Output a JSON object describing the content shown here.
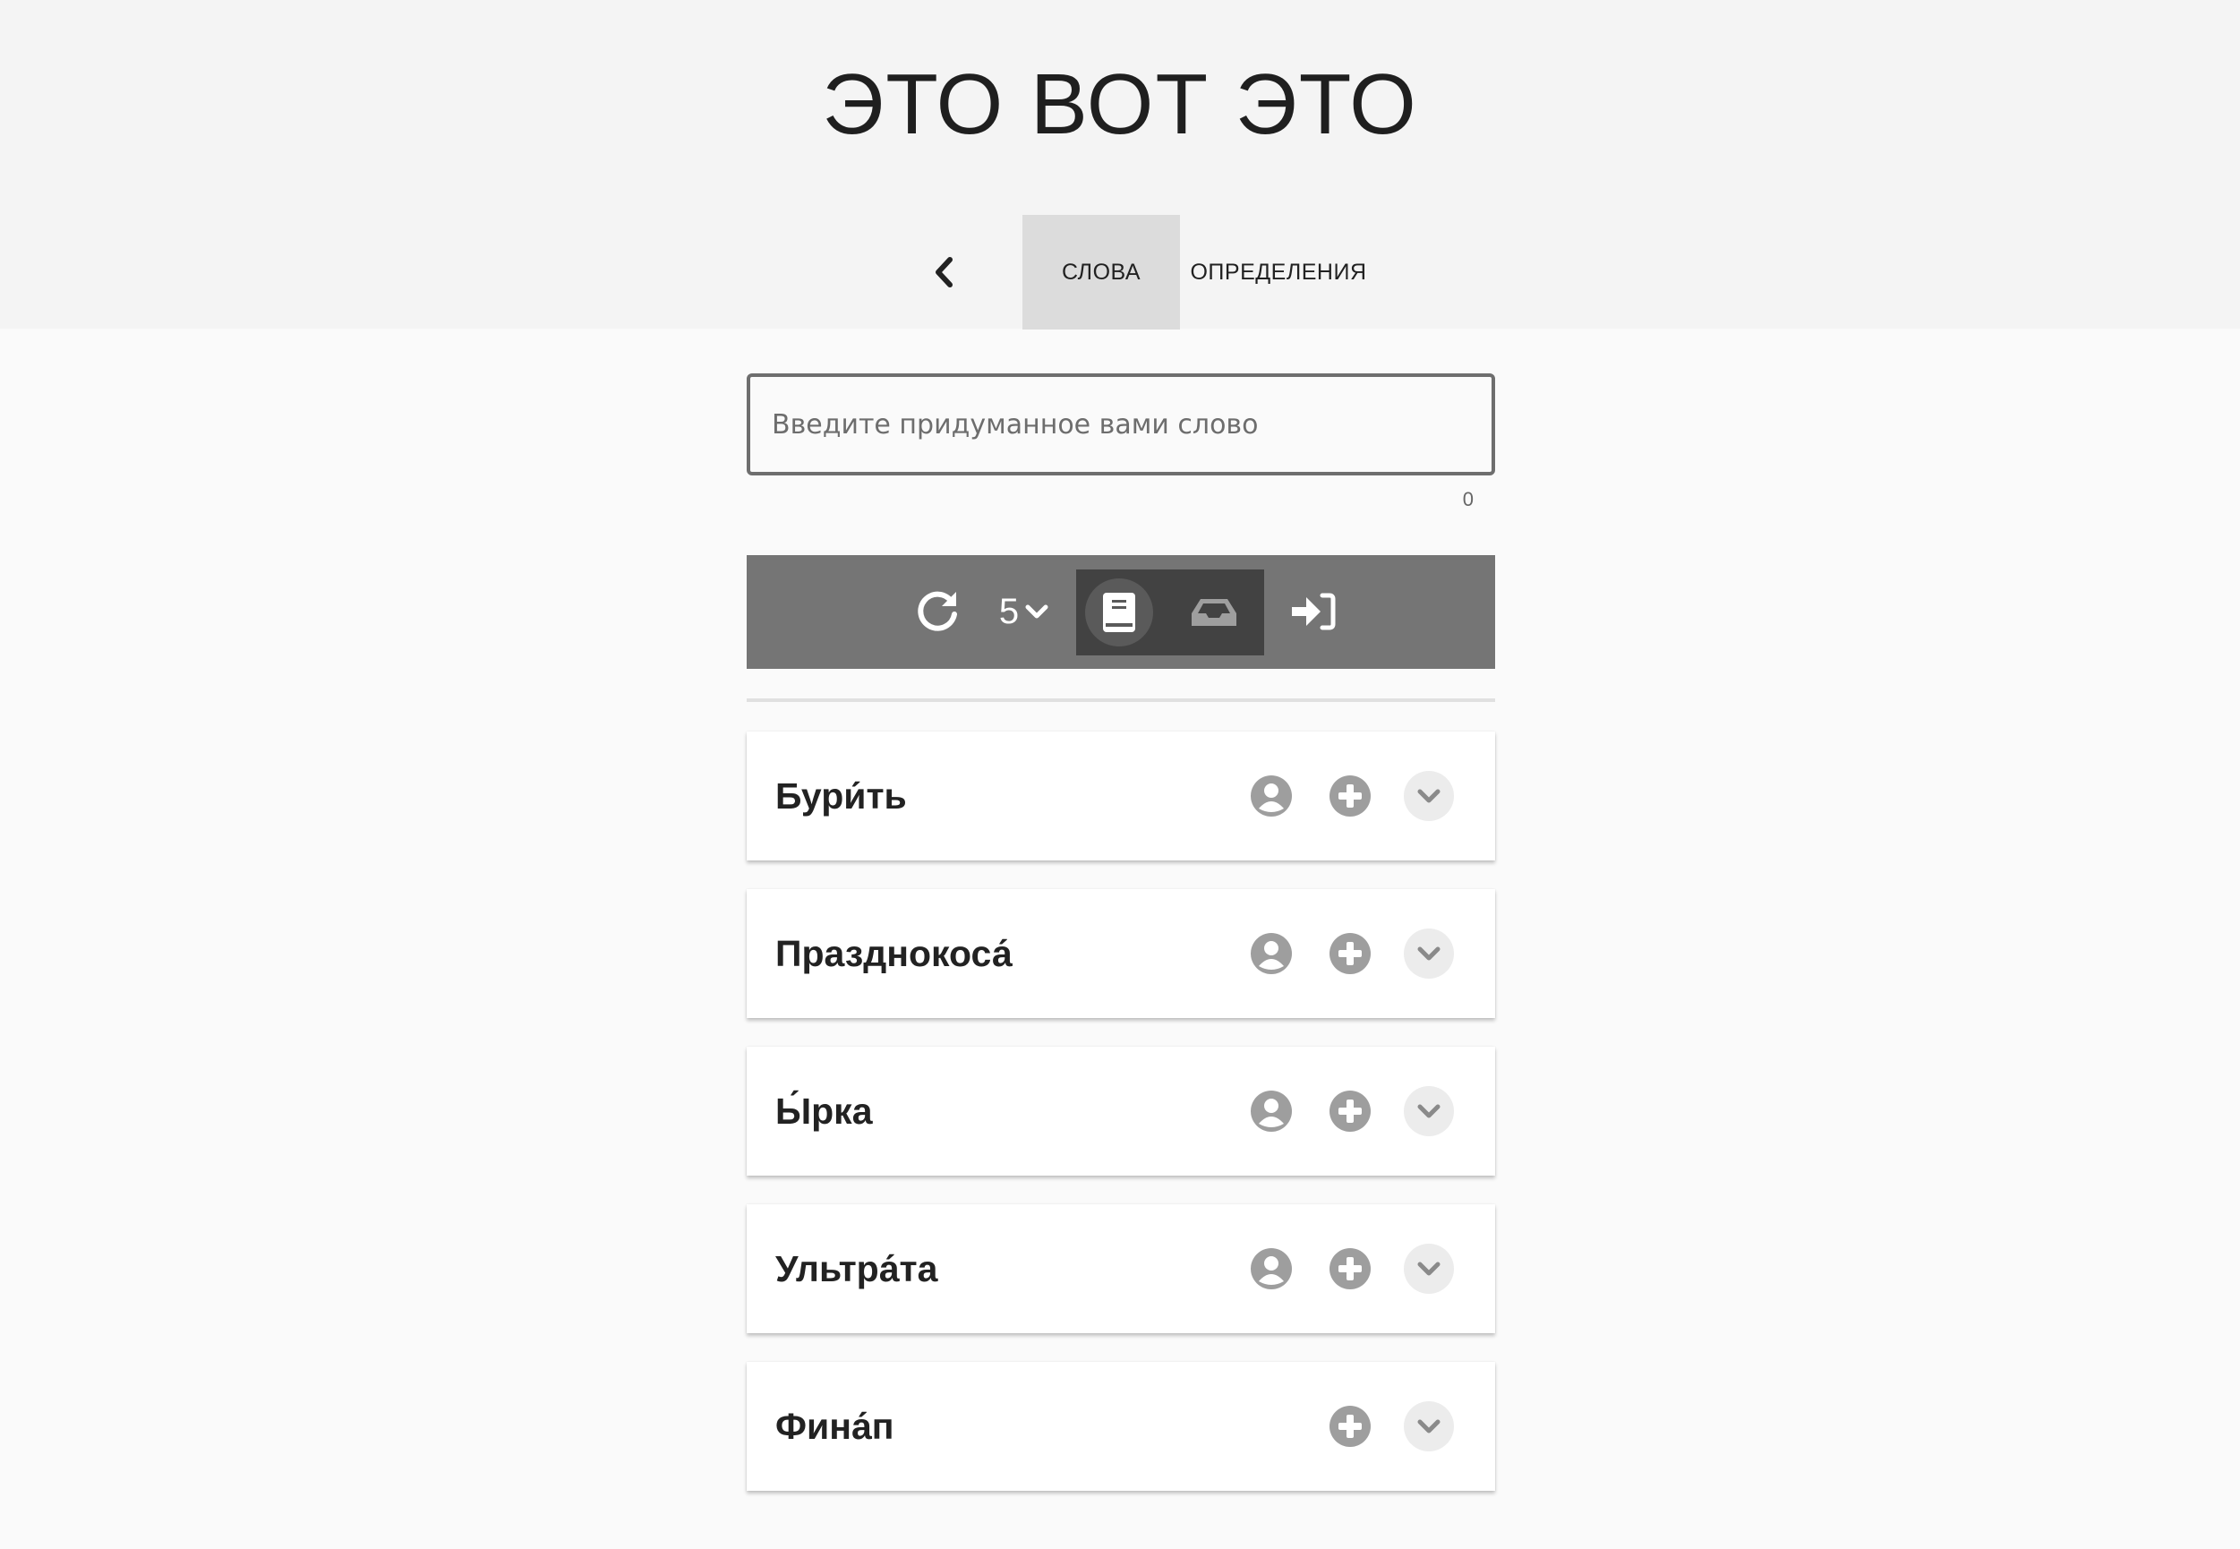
{
  "header": {
    "title": "ЭТО ВОТ ЭТО",
    "tabs": [
      {
        "label": "СЛОВА",
        "active": true
      },
      {
        "label": "ОПРЕДЕЛЕНИЯ",
        "active": false
      }
    ]
  },
  "search": {
    "placeholder": "Введите придуманное вами слово",
    "value": "",
    "char_count": "0"
  },
  "toolbar": {
    "count_value": "5",
    "icons": [
      "refresh-icon",
      "chevron-down-icon",
      "book-icon",
      "inbox-icon",
      "login-icon"
    ]
  },
  "words": [
    {
      "word": "Бури́ть",
      "has_author": true
    },
    {
      "word": "Празднокоса́",
      "has_author": true
    },
    {
      "word": "Ы́рка",
      "has_author": true
    },
    {
      "word": "Ультра́та",
      "has_author": true
    },
    {
      "word": "Фина́п",
      "has_author": false
    }
  ],
  "colors": {
    "header_bg": "#f4f4f4",
    "toolbar_bg": "#757575",
    "toolbar_group_bg": "#424242",
    "active_tab_bg": "#dcdcdc",
    "icon_gray": "#9e9e9e"
  }
}
